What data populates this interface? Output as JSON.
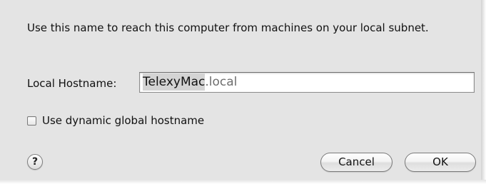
{
  "dialog": {
    "description": "Use this name to reach this computer from machines on your local subnet.",
    "hostname_label": "Local Hostname:",
    "hostname_value": "TelexyMac",
    "hostname_suffix": ".local",
    "dynamic_checkbox_label": "Use dynamic global hostname",
    "dynamic_checkbox_checked": false,
    "help_label": "?",
    "cancel_label": "Cancel",
    "ok_label": "OK"
  },
  "icons": {
    "help": "help-icon"
  }
}
